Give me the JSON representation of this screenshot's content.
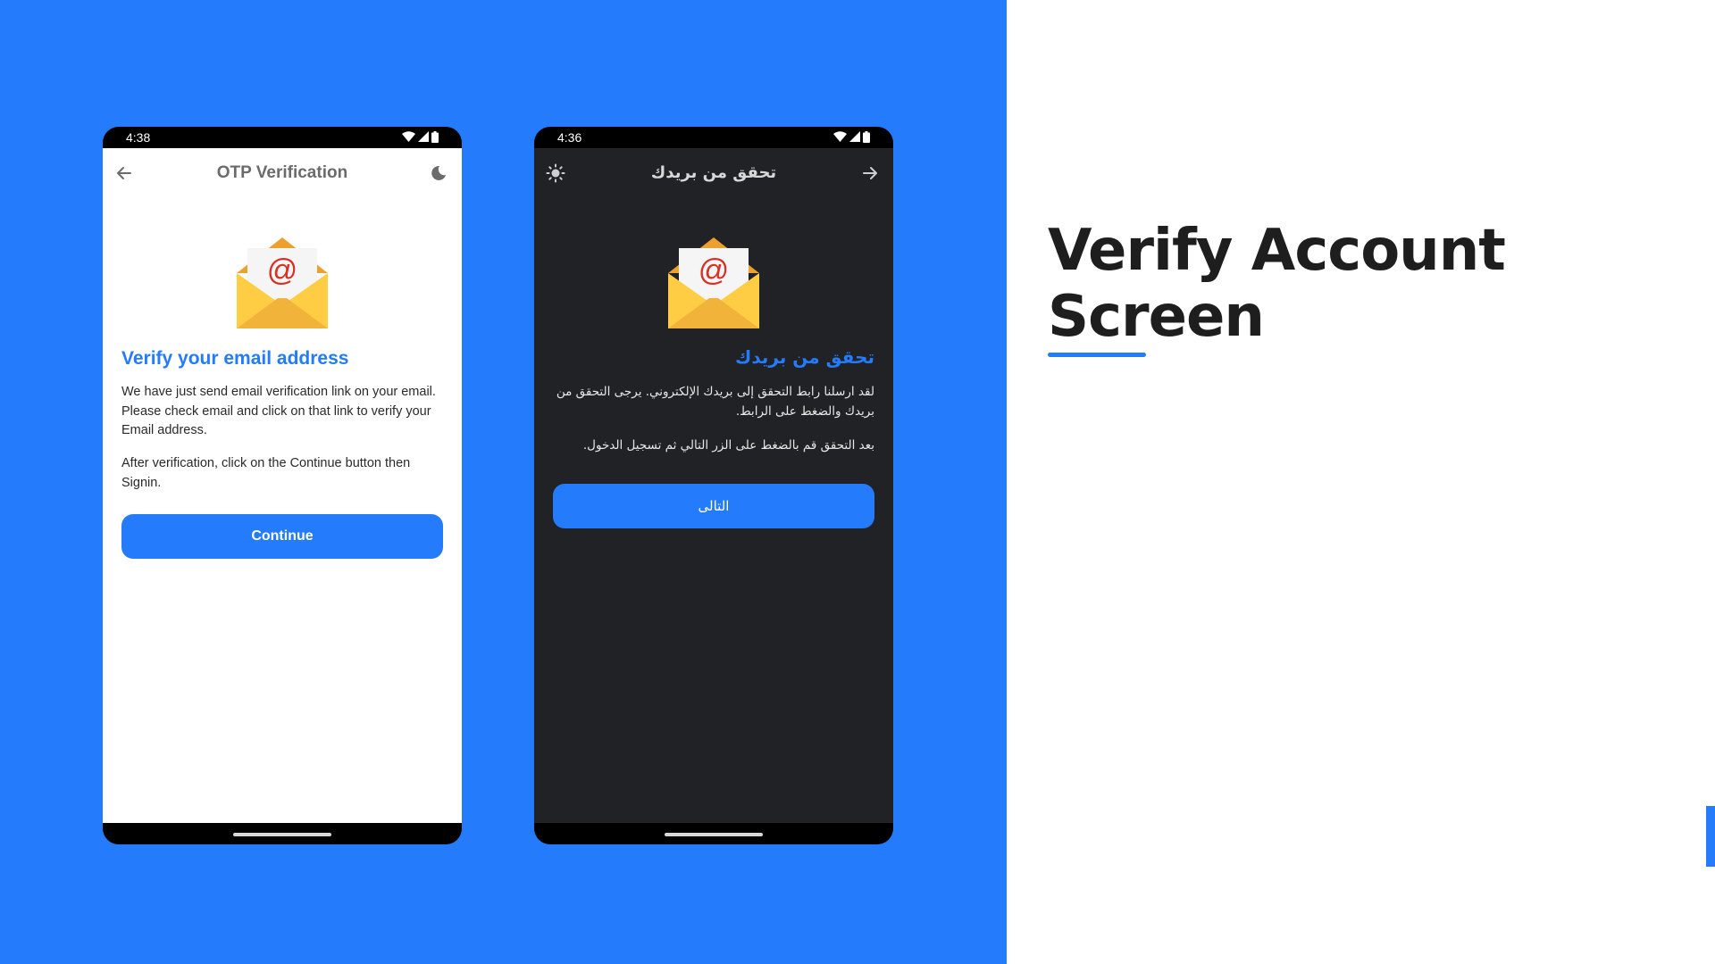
{
  "slide": {
    "headline_line1": "Verify Account",
    "headline_line2": "Screen",
    "accent_color": "#247bfc"
  },
  "light_phone": {
    "status_time": "4:38",
    "title": "OTP Verification",
    "back_icon": "arrow-left-icon",
    "theme_icon": "moon-icon",
    "heading": "Verify your email address",
    "body_1": "We have just send email verification link on your email. Please check email and click on that link to verify your Email address.",
    "body_2": "After verification, click on the Continue button then Signin.",
    "button_label": "Continue"
  },
  "dark_phone": {
    "status_time": "4:36",
    "title": "تحقق من بريدك",
    "theme_icon": "sun-icon",
    "back_icon": "arrow-right-icon",
    "heading": "تحقق من بريدك",
    "body_1": "لقد ارسلنا رابط التحقق إلى بريدك الإلكتروني. يرجى التحقق من بريدك والضغط على الرابط.",
    "body_2": "بعد التحقق قم بالضغط على الزر التالي ثم تسجيل الدخول.",
    "button_label": "التالى"
  }
}
